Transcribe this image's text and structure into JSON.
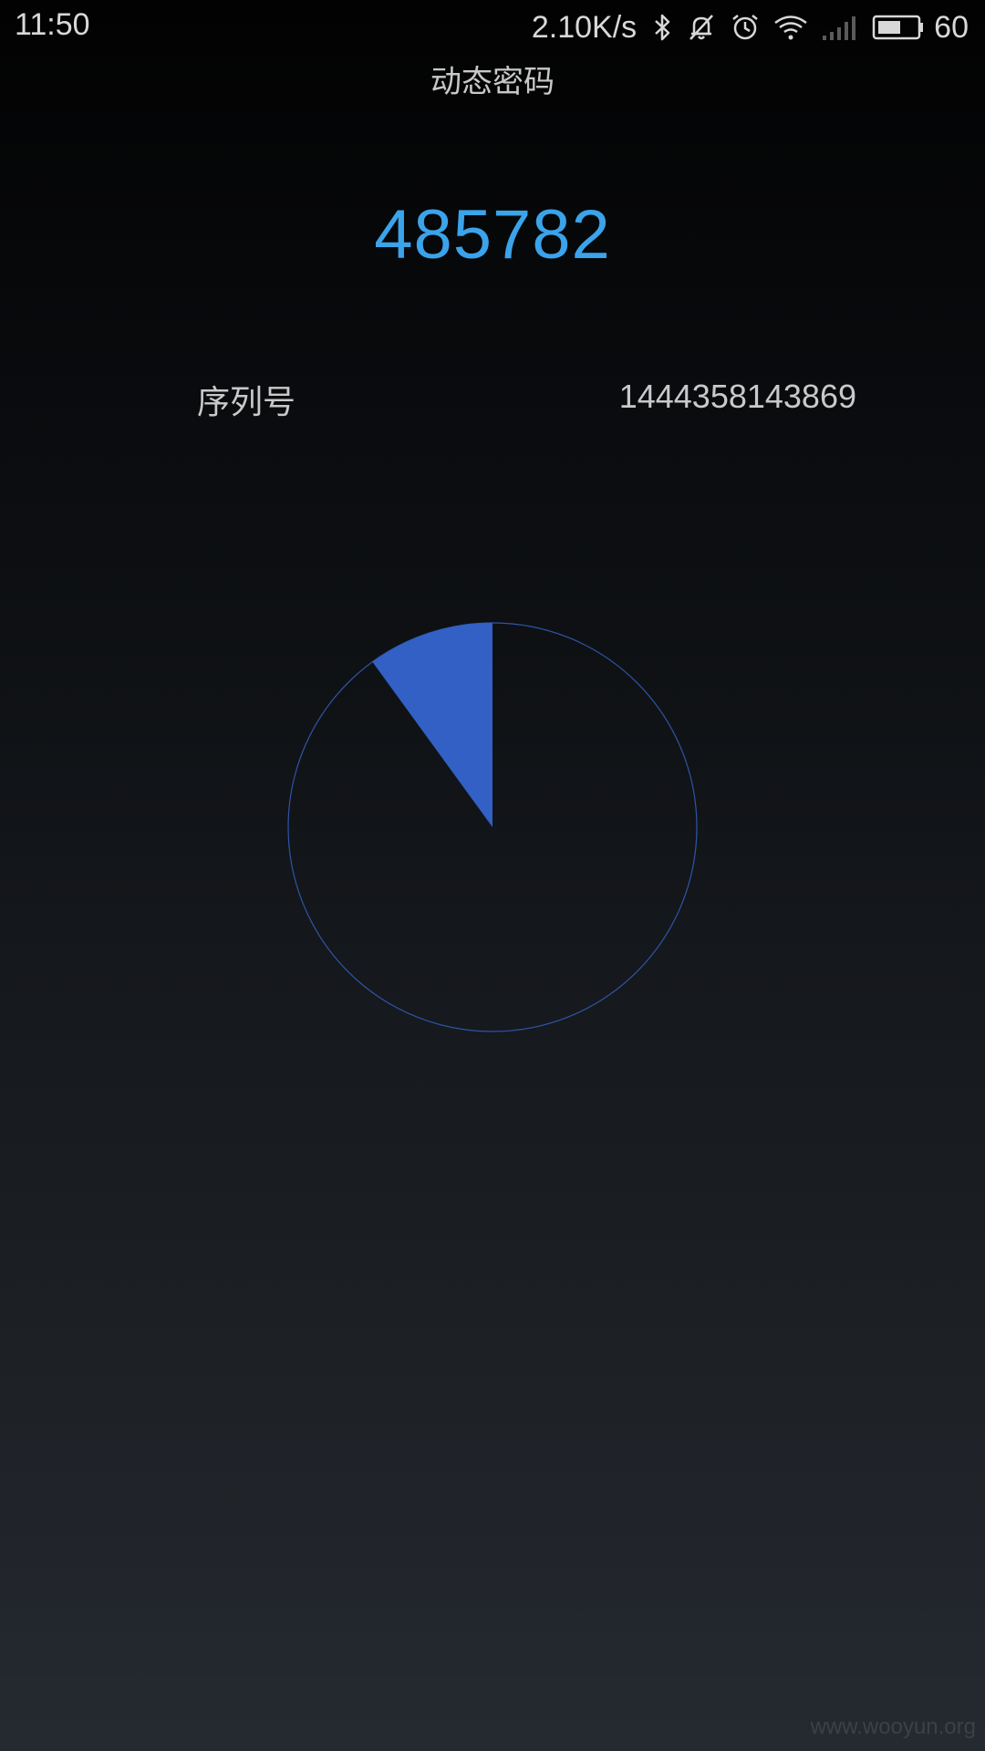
{
  "status_bar": {
    "time": "11:50",
    "network_speed": "2.10K/s",
    "battery_level": "60",
    "icons": [
      "bluetooth-icon",
      "mute-bell-icon",
      "alarm-clock-icon",
      "wifi-icon",
      "signal-icon",
      "battery-icon"
    ]
  },
  "app": {
    "title": "动态密码"
  },
  "token": {
    "code": "485782"
  },
  "serial": {
    "label": "序列号",
    "value": "1444358143869"
  },
  "timer": {
    "elapsed_fraction": 0.1,
    "fill_color": "#3260c4",
    "ring_color": "#2e55a6"
  },
  "watermark": "www.wooyun.org"
}
